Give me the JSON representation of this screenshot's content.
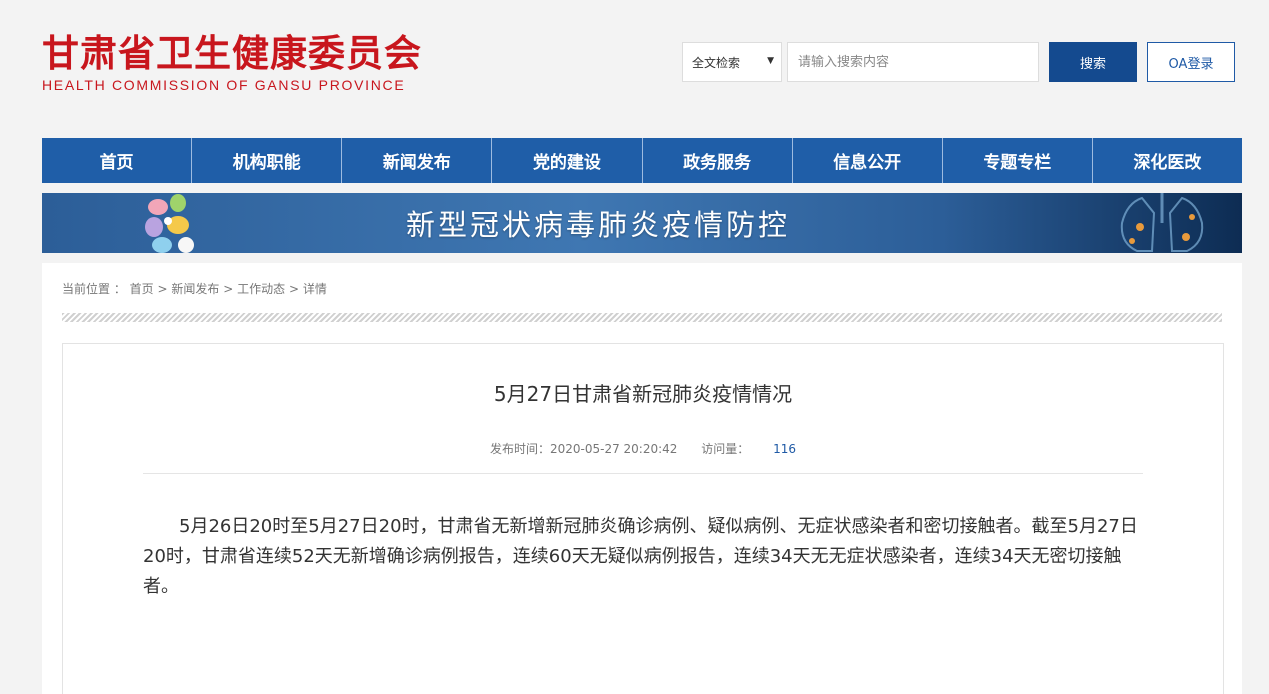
{
  "header": {
    "logo_cn": "甘肃省卫生健康委员会",
    "logo_en": "HEALTH COMMISSION OF GANSU PROVINCE",
    "search_scope": "全文检索",
    "search_placeholder": "请输入搜索内容",
    "search_button": "搜索",
    "oa_button": "OA登录"
  },
  "nav": [
    "首页",
    "机构职能",
    "新闻发布",
    "党的建设",
    "政务服务",
    "信息公开",
    "专题专栏",
    "深化医改"
  ],
  "banner": {
    "title": "新型冠状病毒肺炎疫情防控"
  },
  "breadcrumb": {
    "label": "当前位置 ：",
    "items": [
      "首页",
      "新闻发布",
      "工作动态",
      "详情"
    ],
    "separator": ">"
  },
  "article": {
    "title": "5月27日甘肃省新冠肺炎疫情情况",
    "publish_label": "发布时间：",
    "publish_time": "2020-05-27 20:20:42",
    "visits_label": "访问量：",
    "visits": "116",
    "body": "5月26日20时至5月27日20时，甘肃省无新增新冠肺炎确诊病例、疑似病例、无症状感染者和密切接触者。截至5月27日20时，甘肃省连续52天无新增确诊病例报告，连续60天无疑似病例报告，连续34天无无症状感染者，连续34天无密切接触者。"
  },
  "colors": {
    "brand_red": "#c8161d",
    "nav_blue": "#1f5ea8",
    "button_blue": "#144a8f"
  }
}
